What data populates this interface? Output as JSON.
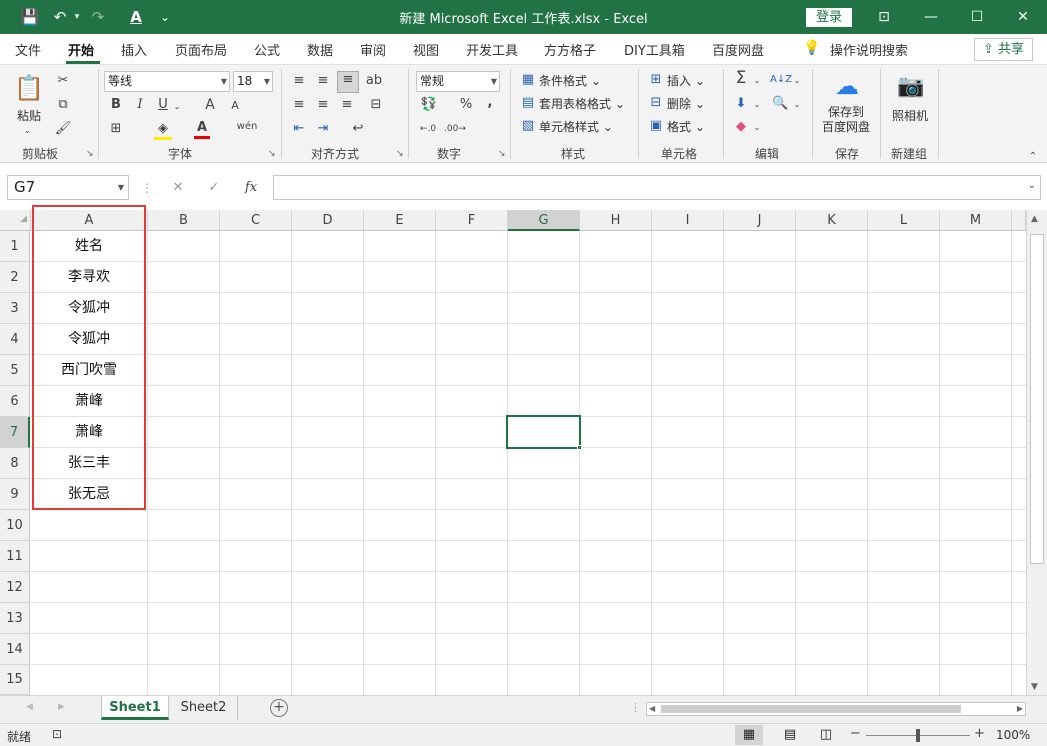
{
  "titlebar": {
    "title": "新建 Microsoft Excel 工作表.xlsx  -  Excel",
    "login": "登录",
    "quick_access": {
      "save": "💾",
      "undo": "↶",
      "redo": "↷",
      "font_color": "A",
      "customize": "⌄"
    },
    "window": {
      "ribbon_display": "⊡",
      "minimize": "—",
      "maximize": "☐",
      "close": "✕"
    }
  },
  "tabs": [
    "文件",
    "开始",
    "插入",
    "页面布局",
    "公式",
    "数据",
    "审阅",
    "视图",
    "开发工具",
    "方方格子",
    "DIY工具箱",
    "百度网盘"
  ],
  "tell_me": "操作说明搜索",
  "share": "共享",
  "ribbon": {
    "clipboard": {
      "label": "剪贴板",
      "paste": "粘贴"
    },
    "font": {
      "label": "字体",
      "name": "等线",
      "size": "18",
      "bold": "B",
      "italic": "I",
      "underline": "U",
      "grow": "A",
      "shrink": "A",
      "color": "A",
      "wen": "wén"
    },
    "alignment": {
      "label": "对齐方式"
    },
    "number": {
      "label": "数字",
      "format": "常规",
      "percent": "%",
      "comma": ","
    },
    "styles": {
      "label": "样式",
      "conditional": "条件格式",
      "table": "套用表格格式",
      "cell": "单元格样式"
    },
    "cells": {
      "label": "单元格",
      "insert": "插入",
      "delete": "删除",
      "format": "格式"
    },
    "editing": {
      "label": "编辑",
      "sum": "Σ",
      "sort": "A↓Z"
    },
    "save": {
      "label": "保存",
      "button": "保存到\n百度网盘"
    },
    "newgroup": {
      "label": "新建组",
      "camera": "照相机"
    }
  },
  "formula_bar": {
    "name_box": "G7",
    "fx": "fx",
    "cancel": "✕",
    "enter": "✓",
    "formula": ""
  },
  "columns": [
    "A",
    "B",
    "C",
    "D",
    "E",
    "F",
    "G",
    "H",
    "I",
    "J",
    "K",
    "L",
    "M"
  ],
  "rows": [
    "1",
    "2",
    "3",
    "4",
    "5",
    "6",
    "7",
    "8",
    "9",
    "10",
    "11",
    "12",
    "13",
    "14",
    "15"
  ],
  "column_a": [
    "姓名",
    "李寻欢",
    "令狐冲",
    "令狐冲",
    "西门吹雪",
    "萧峰",
    "萧峰",
    "张三丰",
    "张无忌"
  ],
  "selected_cell": "G7",
  "sheets": [
    "Sheet1",
    "Sheet2"
  ],
  "active_sheet": "Sheet1",
  "status": {
    "ready": "就绪",
    "zoom": "100%"
  },
  "colors": {
    "accent": "#217346",
    "highlight_box": "#e53935"
  }
}
